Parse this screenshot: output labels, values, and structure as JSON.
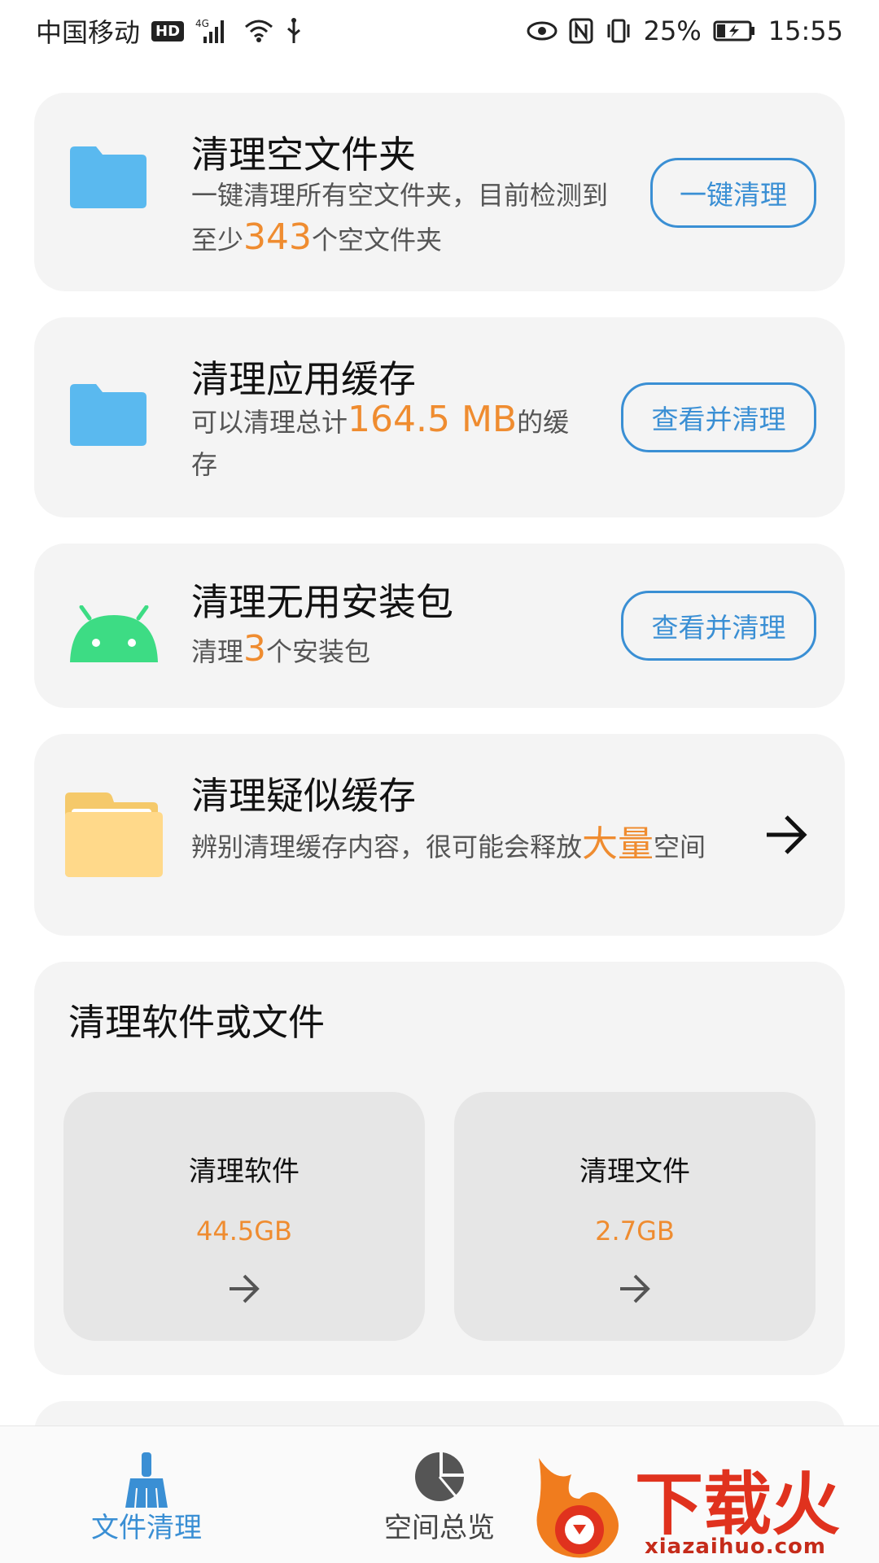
{
  "status_bar": {
    "carrier": "中国移动",
    "hd": "HD",
    "network": "4G",
    "battery": "25%",
    "time": "15:55"
  },
  "cards": {
    "empty_folders": {
      "title": "清理空文件夹",
      "desc_prefix": "一键清理所有空文件夹，目前检测到至少",
      "count": "343",
      "desc_suffix": "个空文件夹",
      "button": "一键清理",
      "icon": "folder-icon"
    },
    "app_cache": {
      "title": "清理应用缓存",
      "desc_prefix": "可以清理总计",
      "size": "164.5 MB",
      "desc_suffix": "的缓存",
      "button": "查看并清理",
      "icon": "folder-icon"
    },
    "apk": {
      "title": "清理无用安装包",
      "desc_prefix": "清理",
      "count": "3",
      "desc_suffix": "个安装包",
      "button": "查看并清理",
      "icon": "android-icon"
    },
    "suspected_cache": {
      "title": "清理疑似缓存",
      "desc_prefix": "辨别清理缓存内容，很可能会释放",
      "highlight": "大量",
      "desc_suffix": "空间",
      "icon": "folder-open-icon"
    }
  },
  "section": {
    "title": "清理软件或文件",
    "tiles": [
      {
        "title": "清理软件",
        "size": "44.5GB"
      },
      {
        "title": "清理文件",
        "size": "2.7GB"
      }
    ]
  },
  "bottom_nav": {
    "items": [
      {
        "label": "文件清理",
        "icon": "broom-icon",
        "active": true
      },
      {
        "label": "空间总览",
        "icon": "pie-chart-icon",
        "active": false
      }
    ]
  },
  "watermark": {
    "text": "下载火",
    "url": "xiazaihuo.com"
  },
  "colors": {
    "accent": "#3a8fd4",
    "highlight": "#ef8c30",
    "card_bg": "#f4f4f4",
    "folder_blue": "#5ab9ef",
    "android_green": "#3ddc84",
    "folder_yellow": "#ffd98a"
  }
}
